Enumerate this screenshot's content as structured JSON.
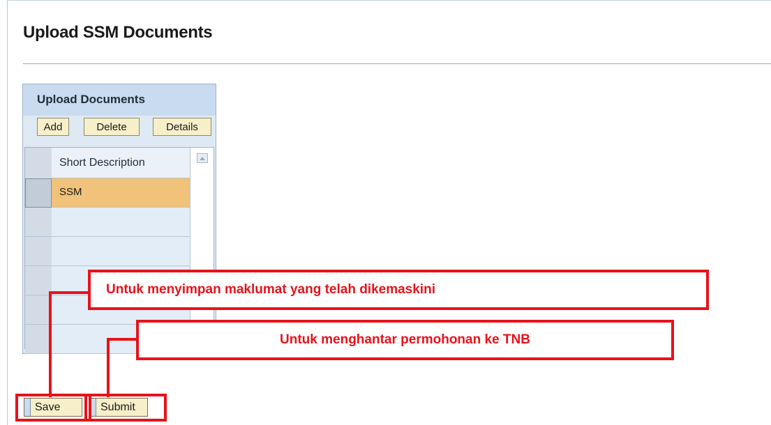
{
  "page": {
    "title": "Upload SSM Documents"
  },
  "panel": {
    "title": "Upload Documents",
    "toolbar": {
      "add_label": "Add",
      "delete_label": "Delete",
      "details_label": "Details"
    },
    "table": {
      "columns": [
        "Short Description"
      ],
      "rows": [
        {
          "short_description": "SSM",
          "selected": true
        },
        {
          "short_description": ""
        },
        {
          "short_description": ""
        },
        {
          "short_description": ""
        },
        {
          "short_description": ""
        },
        {
          "short_description": ""
        }
      ]
    }
  },
  "actions": {
    "save_label": "Save",
    "submit_label": "Submit"
  },
  "annotations": {
    "save_note": "Untuk menyimpan maklumat yang telah dikemaskini",
    "submit_note": "Untuk menghantar permohonan ke TNB"
  },
  "colors": {
    "highlight": "#e8121a",
    "selected_row": "#f0c27a",
    "button_bg": "#f7efc9"
  }
}
